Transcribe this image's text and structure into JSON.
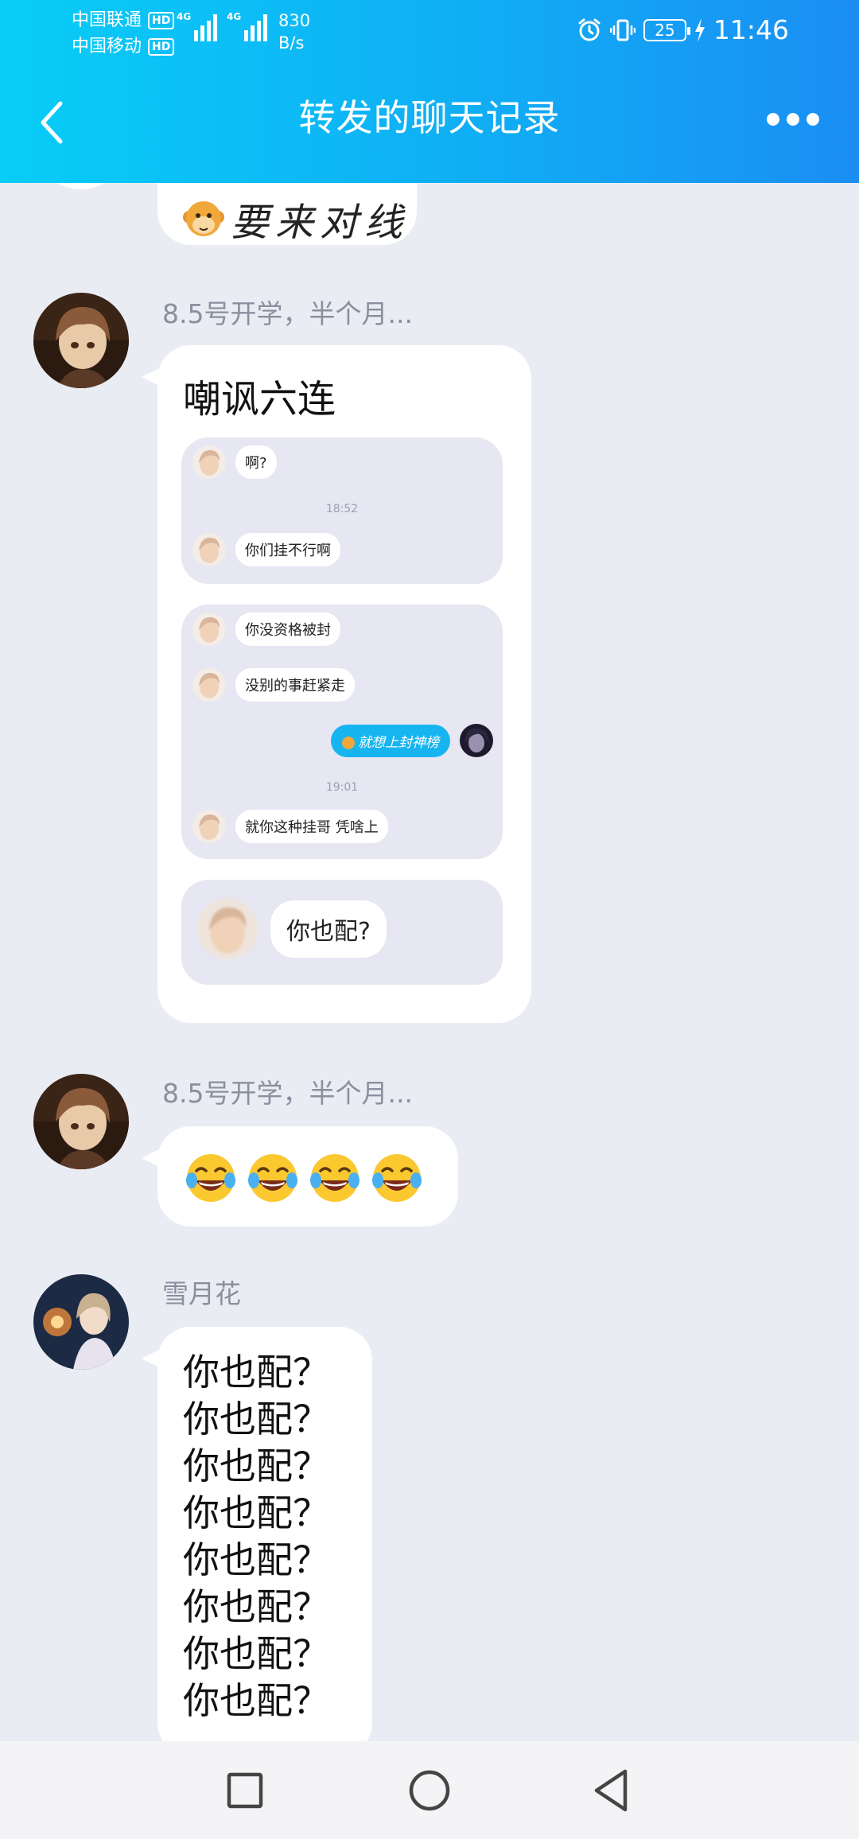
{
  "status_bar": {
    "carrier_1": "中国联通",
    "carrier_2": "中国移动",
    "hd_badge": "HD",
    "network_1": "4G",
    "network_2": "4G",
    "speed_value": "830",
    "speed_unit": "B/s",
    "battery": "25",
    "time": "11:46"
  },
  "header": {
    "title": "转发的聊天记录"
  },
  "messages": [
    {
      "id": "partial-top",
      "text": "要来对线"
    },
    {
      "id": "msg-forward",
      "sender": "8.5号开学，半个月...",
      "card_title": "嘲讽六连",
      "panel_1": {
        "line_1": "啊?",
        "time": "18:52",
        "line_2": "你们挂不行啊"
      },
      "panel_2": {
        "line_1": "你没资格被封",
        "line_2": "没别的事赶紧走",
        "own_line": "就想上封神榜",
        "time": "19:01",
        "line_3": "就你这种挂哥  凭啥上"
      },
      "panel_3": {
        "line": "你也配?"
      }
    },
    {
      "id": "msg-emoji",
      "sender": "8.5号开学，半个月...",
      "emoji_count": 4,
      "emoji_name": "tears-of-joy"
    },
    {
      "id": "msg-repeat",
      "sender": "雪月花",
      "lines": [
        "你也配？",
        "你也配？",
        "你也配？",
        "你也配？",
        "你也配？",
        "你也配？",
        "你也配？",
        "你也配？"
      ]
    }
  ],
  "system_nav": {
    "recent": "square-icon",
    "home": "circle-icon",
    "back": "triangle-icon"
  },
  "colors": {
    "header_start": "#08cdf6",
    "header_end": "#1a8ef3",
    "chat_bg": "#eaecf4",
    "bubble": "#ffffff",
    "own_bubble": "#17b5f0"
  }
}
